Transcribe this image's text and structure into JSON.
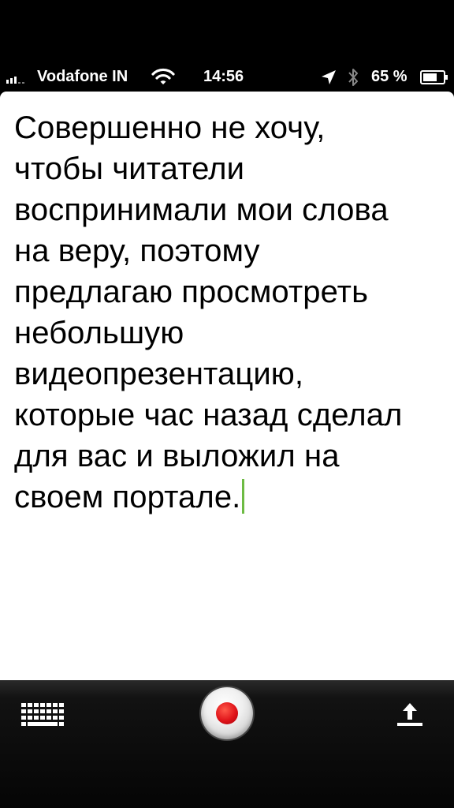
{
  "status_bar": {
    "carrier": "Vodafone IN",
    "time": "14:56",
    "battery_percent": "65 %",
    "icons": [
      "signal-bars-icon",
      "wifi-icon",
      "location-arrow-icon",
      "bluetooth-icon",
      "battery-icon"
    ]
  },
  "document": {
    "lines": [
      "Совершенно не хочу,",
      "чтобы читатели",
      "воспринимали мои слова",
      "на веру, поэтому",
      "предлагаю просмотреть",
      "небольшую",
      "видеопрезентацию,",
      "которые час назад сделал",
      "для вас и выложил на",
      "своем портале."
    ],
    "caret_color": "#6dbb44"
  },
  "toolbar": {
    "buttons": [
      "keyboard-icon",
      "record-icon",
      "share-icon"
    ],
    "record_color": "#e0141a"
  }
}
